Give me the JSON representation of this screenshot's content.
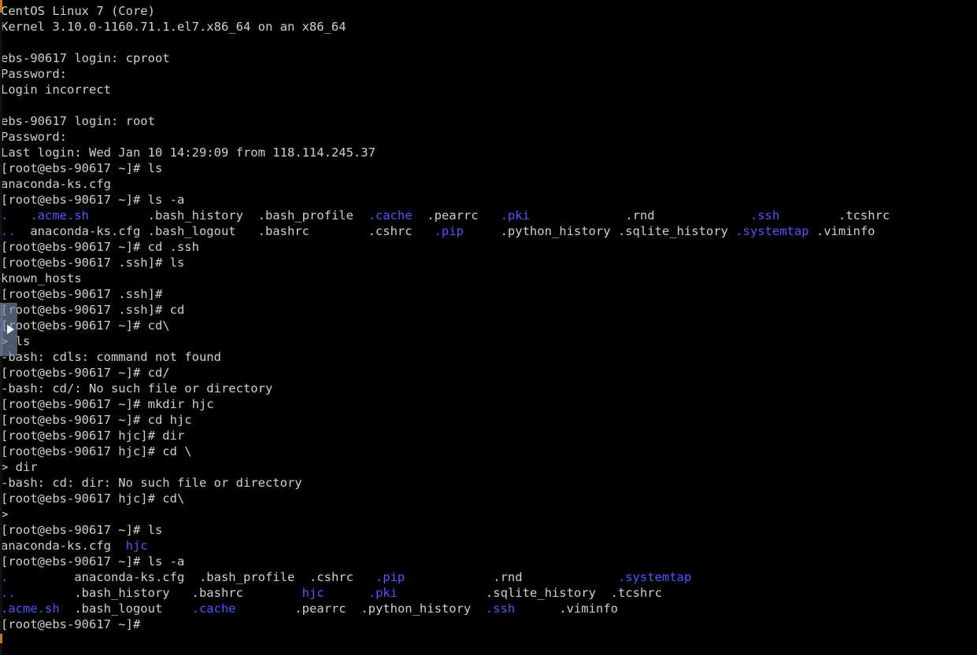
{
  "terminal": {
    "os_banner": "CentOS Linux 7 (Core)",
    "kernel_banner": "Kernel 3.10.0-1160.71.1.el7.x86_64 on an x86_64",
    "hostname": "ebs-90617",
    "background_color": "#000000",
    "text_color": "#d0d0d0",
    "directory_color": "#5555ff",
    "prompt_home": "[root@ebs-90617 ~]#",
    "prompt_ssh": "[root@ebs-90617 .ssh]#",
    "prompt_hjc": "[root@ebs-90617 hjc]#",
    "continuation_prompt": ">"
  },
  "overlay": {
    "play_icon": "play-icon",
    "color": "#7e91af"
  },
  "scrollbar": {
    "track_color": "#101010",
    "marker_color": "#c8781e",
    "thumb_color": "#5a6980"
  },
  "lines": [
    {
      "id": "l01",
      "segments": [
        {
          "t": "CentOS Linux 7 (Core)",
          "c": "default"
        }
      ]
    },
    {
      "id": "l02",
      "segments": [
        {
          "t": "Kernel 3.10.0-1160.71.1.el7.x86_64 on an x86_64",
          "c": "default"
        }
      ]
    },
    {
      "id": "l03",
      "segments": [
        {
          "t": "",
          "c": "default"
        }
      ]
    },
    {
      "id": "l04",
      "segments": [
        {
          "t": "ebs-90617 login: cproot",
          "c": "default"
        }
      ]
    },
    {
      "id": "l05",
      "segments": [
        {
          "t": "Password:",
          "c": "default"
        }
      ]
    },
    {
      "id": "l06",
      "segments": [
        {
          "t": "Login incorrect",
          "c": "default"
        }
      ]
    },
    {
      "id": "l07",
      "segments": [
        {
          "t": "",
          "c": "default"
        }
      ]
    },
    {
      "id": "l08",
      "segments": [
        {
          "t": "ebs-90617 login: root",
          "c": "default"
        }
      ]
    },
    {
      "id": "l09",
      "segments": [
        {
          "t": "Password:",
          "c": "default"
        }
      ]
    },
    {
      "id": "l10",
      "segments": [
        {
          "t": "Last login: Wed Jan 10 14:29:09 from 118.114.245.37",
          "c": "default"
        }
      ]
    },
    {
      "id": "l11",
      "segments": [
        {
          "t": "[root@ebs-90617 ~]# ls",
          "c": "default"
        }
      ]
    },
    {
      "id": "l12",
      "segments": [
        {
          "t": "anaconda-ks.cfg",
          "c": "default"
        }
      ]
    },
    {
      "id": "l13",
      "segments": [
        {
          "t": "[root@ebs-90617 ~]# ls -a",
          "c": "default"
        }
      ]
    },
    {
      "id": "l14",
      "segments": [
        {
          "t": ".",
          "c": "dir"
        },
        {
          "t": "   ",
          "c": "default"
        },
        {
          "t": ".acme.sh",
          "c": "dir"
        },
        {
          "t": "        .bash_history  .bash_profile  ",
          "c": "default"
        },
        {
          "t": ".cache",
          "c": "dir"
        },
        {
          "t": "  .pearrc   ",
          "c": "default"
        },
        {
          "t": ".pki",
          "c": "dir"
        },
        {
          "t": "             .rnd             ",
          "c": "default"
        },
        {
          "t": ".ssh",
          "c": "dir"
        },
        {
          "t": "        .tcshrc",
          "c": "default"
        }
      ]
    },
    {
      "id": "l15",
      "segments": [
        {
          "t": "..",
          "c": "dir"
        },
        {
          "t": "  anaconda-ks.cfg .bash_logout   .bashrc        .cshrc   ",
          "c": "default"
        },
        {
          "t": ".pip",
          "c": "dir"
        },
        {
          "t": "     .python_history .sqlite_history ",
          "c": "default"
        },
        {
          "t": ".systemtap",
          "c": "dir"
        },
        {
          "t": " .viminfo",
          "c": "default"
        }
      ]
    },
    {
      "id": "l16",
      "segments": [
        {
          "t": "[root@ebs-90617 ~]# cd .ssh",
          "c": "default"
        }
      ]
    },
    {
      "id": "l17",
      "segments": [
        {
          "t": "[root@ebs-90617 .ssh]# ls",
          "c": "default"
        }
      ]
    },
    {
      "id": "l18",
      "segments": [
        {
          "t": "known_hosts",
          "c": "default"
        }
      ]
    },
    {
      "id": "l19",
      "segments": [
        {
          "t": "[root@ebs-90617 .ssh]#",
          "c": "default"
        }
      ]
    },
    {
      "id": "l20",
      "segments": [
        {
          "t": "[root@ebs-90617 .ssh]# cd",
          "c": "default"
        }
      ]
    },
    {
      "id": "l21",
      "segments": [
        {
          "t": "[root@ebs-90617 ~]# cd\\",
          "c": "default"
        }
      ]
    },
    {
      "id": "l22",
      "segments": [
        {
          "t": "> ls",
          "c": "default"
        }
      ]
    },
    {
      "id": "l23",
      "segments": [
        {
          "t": "-bash: cdls: command not found",
          "c": "default"
        }
      ]
    },
    {
      "id": "l24",
      "segments": [
        {
          "t": "[root@ebs-90617 ~]# cd/",
          "c": "default"
        }
      ]
    },
    {
      "id": "l25",
      "segments": [
        {
          "t": "-bash: cd/: No such file or directory",
          "c": "default"
        }
      ]
    },
    {
      "id": "l26",
      "segments": [
        {
          "t": "[root@ebs-90617 ~]# mkdir hjc",
          "c": "default"
        }
      ]
    },
    {
      "id": "l27",
      "segments": [
        {
          "t": "[root@ebs-90617 ~]# cd hjc",
          "c": "default"
        }
      ]
    },
    {
      "id": "l28",
      "segments": [
        {
          "t": "[root@ebs-90617 hjc]# dir",
          "c": "default"
        }
      ]
    },
    {
      "id": "l29",
      "segments": [
        {
          "t": "[root@ebs-90617 hjc]# cd \\",
          "c": "default"
        }
      ]
    },
    {
      "id": "l30",
      "segments": [
        {
          "t": "> dir",
          "c": "default"
        }
      ]
    },
    {
      "id": "l31",
      "segments": [
        {
          "t": "-bash: cd: dir: No such file or directory",
          "c": "default"
        }
      ]
    },
    {
      "id": "l32",
      "segments": [
        {
          "t": "[root@ebs-90617 hjc]# cd\\",
          "c": "default"
        }
      ]
    },
    {
      "id": "l33",
      "segments": [
        {
          "t": ">",
          "c": "default"
        }
      ]
    },
    {
      "id": "l34",
      "segments": [
        {
          "t": "[root@ebs-90617 ~]# ls",
          "c": "default"
        }
      ]
    },
    {
      "id": "l35",
      "segments": [
        {
          "t": "anaconda-ks.cfg  ",
          "c": "default"
        },
        {
          "t": "hjc",
          "c": "dir"
        }
      ]
    },
    {
      "id": "l36",
      "segments": [
        {
          "t": "[root@ebs-90617 ~]# ls -a",
          "c": "default"
        }
      ]
    },
    {
      "id": "l37",
      "segments": [
        {
          "t": ".",
          "c": "dir"
        },
        {
          "t": "         anaconda-ks.cfg  .bash_profile  .cshrc   ",
          "c": "default"
        },
        {
          "t": ".pip",
          "c": "dir"
        },
        {
          "t": "            .rnd             ",
          "c": "default"
        },
        {
          "t": ".systemtap",
          "c": "dir"
        }
      ]
    },
    {
      "id": "l38",
      "segments": [
        {
          "t": "..",
          "c": "dir"
        },
        {
          "t": "        .bash_history   .bashrc        ",
          "c": "default"
        },
        {
          "t": "hjc",
          "c": "dir"
        },
        {
          "t": "      ",
          "c": "default"
        },
        {
          "t": ".pki",
          "c": "dir"
        },
        {
          "t": "            .sqlite_history  .tcshrc",
          "c": "default"
        }
      ]
    },
    {
      "id": "l39",
      "segments": [
        {
          "t": ".acme.sh",
          "c": "dir"
        },
        {
          "t": "  .bash_logout    ",
          "c": "default"
        },
        {
          "t": ".cache",
          "c": "dir"
        },
        {
          "t": "        .pearrc  .python_history  ",
          "c": "default"
        },
        {
          "t": ".ssh",
          "c": "dir"
        },
        {
          "t": "      .viminfo",
          "c": "default"
        }
      ]
    },
    {
      "id": "l40",
      "segments": [
        {
          "t": "[root@ebs-90617 ~]#",
          "c": "default"
        }
      ]
    }
  ]
}
